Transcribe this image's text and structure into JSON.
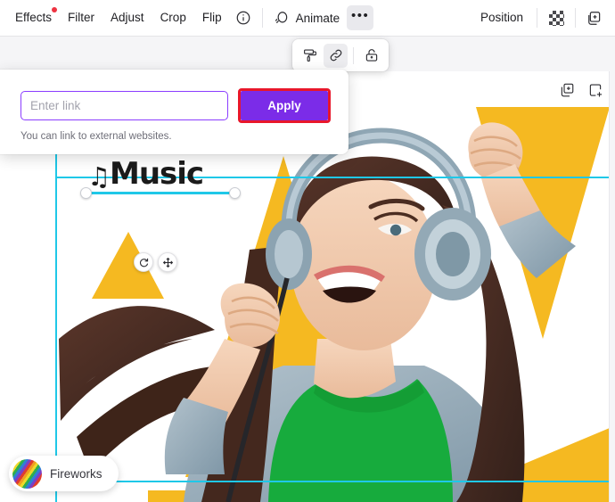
{
  "toolbar": {
    "items": [
      {
        "label": "Effects",
        "name": "toolbar-effects",
        "badge": true
      },
      {
        "label": "Filter",
        "name": "toolbar-filter",
        "badge": false
      },
      {
        "label": "Adjust",
        "name": "toolbar-adjust",
        "badge": false
      },
      {
        "label": "Crop",
        "name": "toolbar-crop",
        "badge": false
      },
      {
        "label": "Flip",
        "name": "toolbar-flip",
        "badge": false
      }
    ],
    "info_icon": "info-circle-icon",
    "animate_label": "Animate",
    "animate_icon": "animate-icon",
    "more_label": "•••",
    "more_icon": "more-options-icon",
    "position_label": "Position",
    "transparency_icon": "transparency-checkerboard-icon",
    "duplicate_icon": "duplicate-icon"
  },
  "page_actions": {
    "duplicate_page_icon": "duplicate-page-icon",
    "add_page_icon": "add-page-icon"
  },
  "float_toolbar": {
    "paint_roller_icon": "paint-roller-icon",
    "link_icon": "link-icon",
    "lock_icon": "lock-icon"
  },
  "link_panel": {
    "input_value": "",
    "input_placeholder": "Enter link",
    "apply_label": "Apply",
    "help_text": "You can link to external websites.",
    "input_border_color": "#8b3dff",
    "apply_bg_color": "#7b2ce8",
    "highlight_color": "#e8172b"
  },
  "canvas": {
    "selected_text": "Music",
    "note_glyph": "♫",
    "rotate_icon": "rotate-icon",
    "move_icon": "move-icon",
    "selection_color": "#1fc8e8",
    "accent_yellow": "#f5b921",
    "shirt_green": "#17ab3d"
  },
  "fireworks": {
    "label": "Fireworks",
    "icon": "fireworks-avatar-icon"
  }
}
